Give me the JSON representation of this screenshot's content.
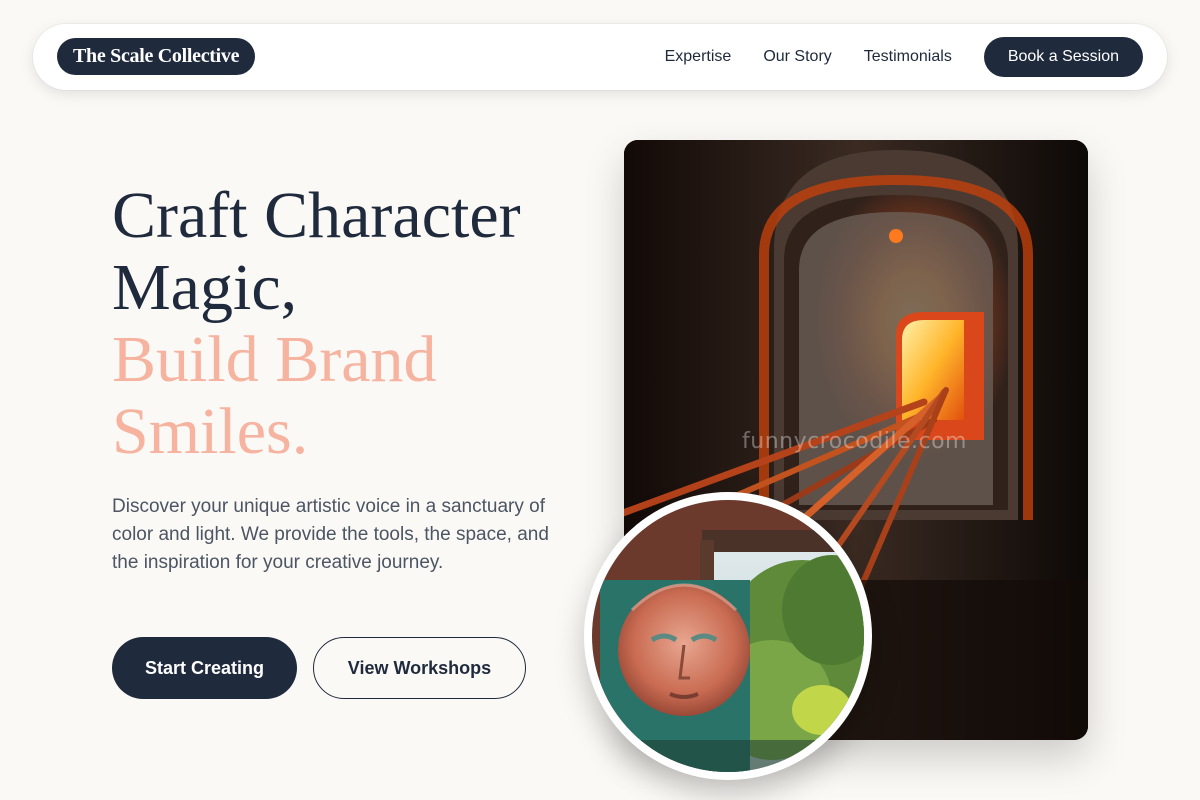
{
  "nav": {
    "logo": "The Scale Collective",
    "links": [
      "Expertise",
      "Our Story",
      "Testimonials"
    ],
    "cta": "Book a Session"
  },
  "hero": {
    "headline_line1": "Craft Character",
    "headline_line2": "Magic,",
    "headline_accent1": "Build Brand",
    "headline_accent2": "Smiles.",
    "description": "Discover your unique artistic voice in a sanctuary of color and light. We provide the tools, the space, and the inspiration for your creative journey.",
    "primary_cta": "Start Creating",
    "secondary_cta": "View Workshops"
  },
  "images": {
    "main_icon": "glass-furnace-photo",
    "main_watermark": "funnycrocodile.com",
    "circle_icon": "painted-sun-mural-photo"
  },
  "colors": {
    "navy": "#1f2a3d",
    "accent": "#f6b3a0",
    "background": "#fbf9f5",
    "body_text": "#4b5563"
  }
}
